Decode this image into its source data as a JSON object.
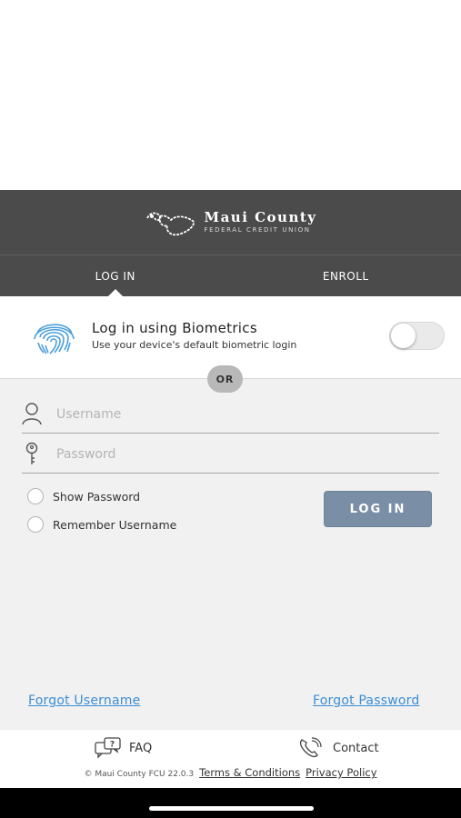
{
  "brand": {
    "name": "Maui County",
    "subtitle": "FEDERAL CREDIT UNION"
  },
  "tabs": [
    {
      "label": "LOG IN",
      "active": true
    },
    {
      "label": "ENROLL",
      "active": false
    }
  ],
  "biometrics": {
    "title": "Log in using Biometrics",
    "subtitle": "Use your device's default biometric login",
    "enabled": false
  },
  "divider_label": "OR",
  "form": {
    "username_placeholder": "Username",
    "password_placeholder": "Password",
    "show_password_label": "Show Password",
    "remember_username_label": "Remember Username",
    "login_button": "LOG IN"
  },
  "links": {
    "forgot_username": "Forgot Username",
    "forgot_password": "Forgot Password"
  },
  "footer": {
    "faq_label": "FAQ",
    "contact_label": "Contact",
    "copyright": "© Maui County FCU 22.0.3",
    "terms": "Terms & Conditions",
    "privacy": "Privacy Policy"
  },
  "colors": {
    "header_bg": "#4b4b4b",
    "button_bg": "#7a8fa6",
    "link": "#3b8ed6",
    "form_bg": "#f1f1f1"
  },
  "icons": {
    "logo": "maui-island-logo",
    "biometric": "fingerprint-icon",
    "username": "user-icon",
    "password": "key-icon",
    "faq": "faq-chat-icon",
    "contact": "phone-icon"
  }
}
